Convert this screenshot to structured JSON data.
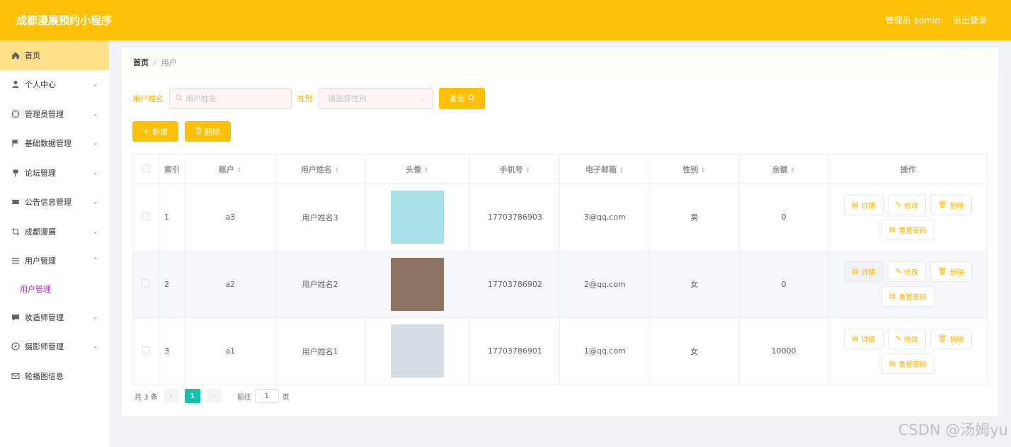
{
  "header": {
    "app_title": "成都漫展预约小程序",
    "admin_label": "管理员 admin",
    "logout_label": "退出登录"
  },
  "sidebar": {
    "items": [
      {
        "label": "首页",
        "icon": "home-icon",
        "active": true
      },
      {
        "label": "个人中心",
        "icon": "user-icon"
      },
      {
        "label": "管理员管理",
        "icon": "crosshair-icon"
      },
      {
        "label": "基础数据管理",
        "icon": "flag-icon"
      },
      {
        "label": "论坛管理",
        "icon": "pin-icon"
      },
      {
        "label": "公告信息管理",
        "icon": "ticket-icon"
      },
      {
        "label": "成都漫展",
        "icon": "crop-icon"
      },
      {
        "label": "用户管理",
        "icon": "list-icon",
        "expanded": true
      },
      {
        "label": "妆造师管理",
        "icon": "chat-icon"
      },
      {
        "label": "摄影师管理",
        "icon": "compass-icon"
      },
      {
        "label": "轮播图信息",
        "icon": "mail-icon"
      }
    ],
    "submenu_label": "用户管理"
  },
  "breadcrumb": {
    "home": "首页",
    "separator": "/",
    "current": "用户"
  },
  "search": {
    "name_label": "用户姓名",
    "name_placeholder": "用户姓名",
    "gender_label": "性别",
    "gender_placeholder": "请选择性别",
    "query_label": "查询"
  },
  "actions": {
    "add_label": "新增",
    "delete_label": "删除"
  },
  "table": {
    "headers": {
      "index": "索引",
      "account": "账户",
      "name": "用户姓名",
      "avatar": "头像",
      "phone": "手机号",
      "email": "电子邮箱",
      "gender": "性别",
      "balance": "余额",
      "ops": "操作"
    },
    "rows": [
      {
        "index": "1",
        "account": "a3",
        "name": "用户姓名3",
        "phone": "17703786903",
        "email": "3@qq.com",
        "gender": "男",
        "balance": "0",
        "avatar_color": "#a8dfe6"
      },
      {
        "index": "2",
        "account": "a2",
        "name": "用户姓名2",
        "phone": "17703786902",
        "email": "2@qq.com",
        "gender": "女",
        "balance": "0",
        "avatar_color": "#8a7466"
      },
      {
        "index": "3",
        "account": "a1",
        "name": "用户姓名1",
        "phone": "17703786901",
        "email": "1@qq.com",
        "gender": "女",
        "balance": "10000",
        "avatar_color": "#d6dde6"
      }
    ],
    "op_labels": {
      "detail": "详情",
      "edit": "修改",
      "delete": "删除",
      "reset_password": "重置密码"
    }
  },
  "pagination": {
    "total_text": "共 3 条",
    "current_page": "1",
    "goto_label": "前往",
    "goto_value": "1",
    "page_unit": "页"
  },
  "watermark": "CSDN @汤姆yu"
}
